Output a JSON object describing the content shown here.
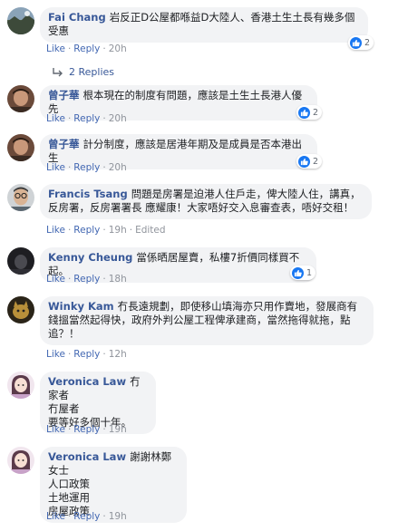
{
  "ui": {
    "like_label": "Like",
    "reply_label": "Reply",
    "separator": "·",
    "edited_label": "Edited",
    "colors": {
      "name": "#385898",
      "link": "#4267b2",
      "meta": "#90949c",
      "bubble": "#f2f3f5",
      "like_icon": "#1877f2"
    }
  },
  "comments": [
    {
      "author": "Fai Chang",
      "text": "岩反正D公屋都喺益D大陸人、香港土生土長有幾多個受惠",
      "time": "20h",
      "reactions": "2",
      "replies": "2 Replies",
      "avatar": "landscape-photo"
    },
    {
      "author": "曾子華",
      "text": "根本現在的制度有問題，應該是土生土長港人優先",
      "time": "20h",
      "reactions": "2",
      "avatar": "person-photo"
    },
    {
      "author": "曾子華",
      "text": "計分制度，應該是居港年期及是成員是否本港出生",
      "time": "20h",
      "reactions": "2",
      "avatar": "person-photo"
    },
    {
      "author": "Francis Tsang",
      "text": "問題是房署是迫港人住戶走，俾大陸人住，講真，反房署，反房署署長 應耀康！大家唔好交入息審查表，唔好交租！",
      "time": "19h",
      "avatar": "man-glasses-photo"
    },
    {
      "author": "Kenny Cheung",
      "text": "當係晒居屋賣，私樓7折價同樣買不起。",
      "time": "18h",
      "reactions": "1",
      "avatar": "dark-photo"
    },
    {
      "author": "Winky Kam",
      "text": "冇長遠規劃，即使移山填海亦只用作賣地，發展商有錢搵當然起得快，政府外判公屋工程俾承建商，當然拖得就拖，點追？！",
      "time": "12h",
      "avatar": "cat-photo"
    },
    {
      "author": "Veronica Law",
      "text": "冇家者\n冇屋者\n要等好多個十年。",
      "time": "19h",
      "avatar": "girl-illustration"
    },
    {
      "author": "Veronica Law",
      "text": "謝謝林鄭女士\n人口政策\n土地運用\n房屋政策",
      "time": "19h",
      "avatar": "girl-illustration"
    }
  ]
}
